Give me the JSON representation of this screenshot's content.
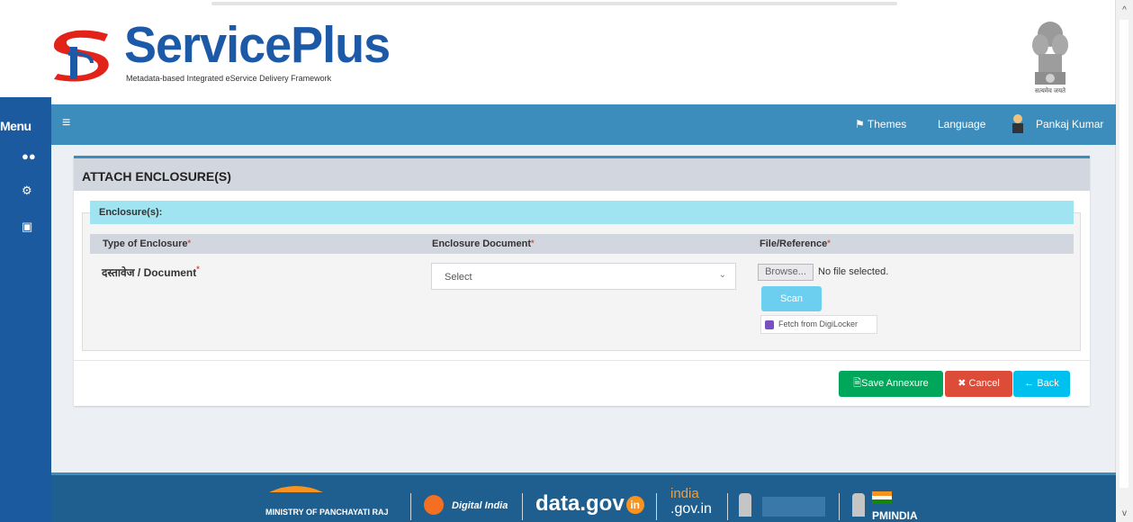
{
  "header": {
    "brand": "ServicePlus",
    "tagline": "Metadata-based Integrated eService Delivery Framework",
    "emblem_text": "सत्यमेव जयते"
  },
  "sidebar": {
    "menu_label": "Menu",
    "icons": [
      "users-icon",
      "cogs-icon",
      "window-icon"
    ]
  },
  "navbar": {
    "themes": "Themes",
    "language": "Language",
    "user": "Pankaj Kumar"
  },
  "panel": {
    "title": "ATTACH ENCLOSURE(S)",
    "section_label": "Enclosure(s):",
    "columns": {
      "type": "Type of Enclosure",
      "document": "Enclosure Document",
      "file": "File/Reference"
    },
    "row": {
      "type_label": "दस्तावेज / Document",
      "select_value": "Select",
      "browse_label": "Browse...",
      "file_status": "No file selected.",
      "scan_label": "Scan",
      "digilocker_label": "Fetch from DigiLocker"
    },
    "buttons": {
      "save": "Save Annexure",
      "cancel": "Cancel",
      "back": "Back"
    }
  },
  "footer": {
    "ministry": "MINISTRY OF PANCHAYATI RAJ",
    "digital_india": "Digital India",
    "datagov": "data.gov",
    "india_gov": "india",
    "india_gov_tld": ".gov.in",
    "pmindia": "PMINDIA"
  },
  "colors": {
    "brand_blue": "#1c5aa8",
    "navbar": "#3c8dbc",
    "sidebar": "#1c5aa0",
    "save": "#00a65a",
    "cancel": "#dd4b39",
    "back": "#00c0ef",
    "footer": "#1f5f90"
  }
}
